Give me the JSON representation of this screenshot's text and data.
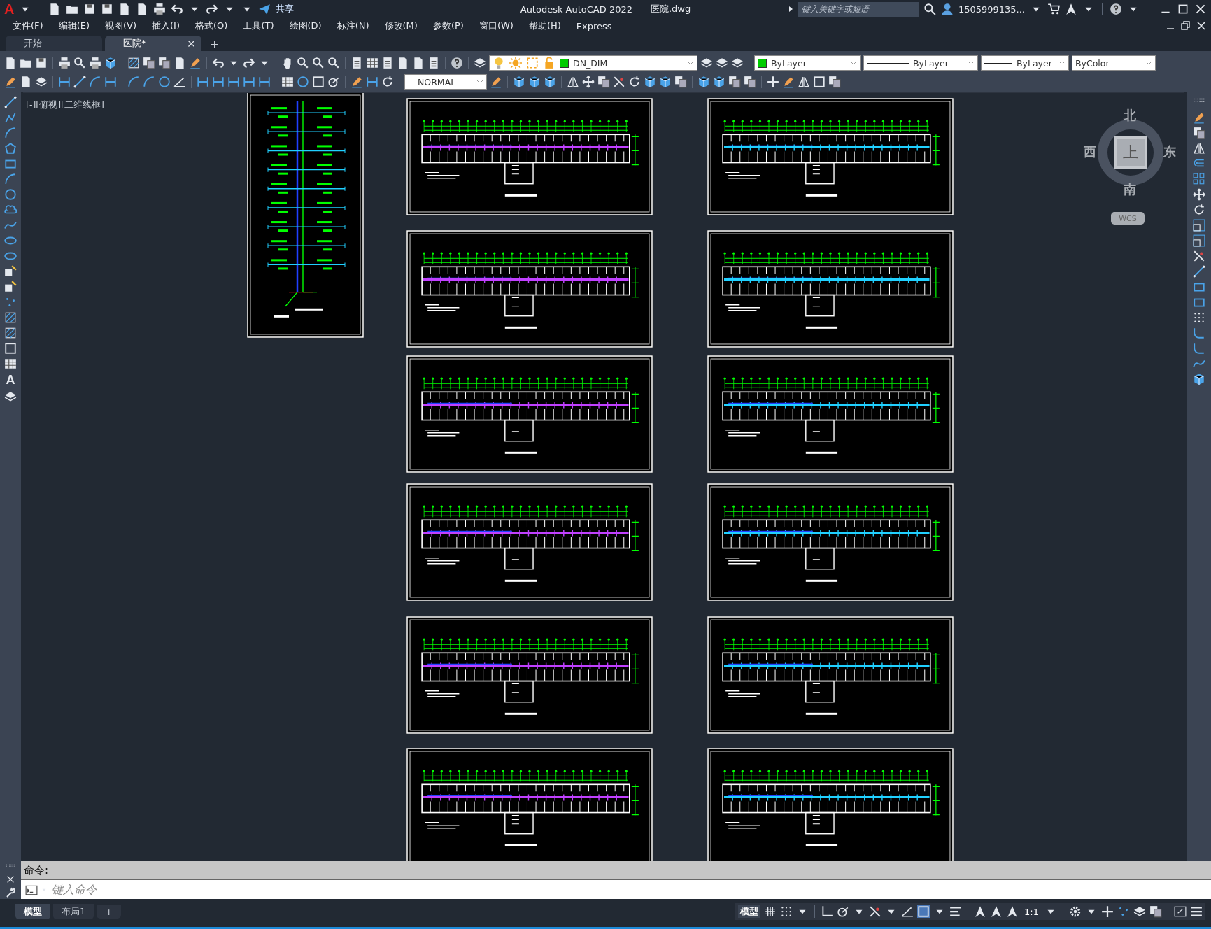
{
  "title_bar": {
    "logo": "A",
    "share": "共享",
    "app_title": "Autodesk AutoCAD 2022",
    "file_name": "医院.dwg",
    "search": {
      "placeholder": "键入关键字或短语"
    },
    "user": "1505999135..."
  },
  "menu": [
    "文件(F)",
    "编辑(E)",
    "视图(V)",
    "插入(I)",
    "格式(O)",
    "工具(T)",
    "绘图(D)",
    "标注(N)",
    "修改(M)",
    "参数(P)",
    "窗口(W)",
    "帮助(H)",
    "Express"
  ],
  "tabs": [
    {
      "label": "开始",
      "selected": false,
      "closable": false
    },
    {
      "label": "医院*",
      "selected": true,
      "closable": true
    }
  ],
  "new_tab": "+",
  "properties": {
    "layer": "DN_DIM",
    "color_setting": "ByLayer",
    "linetype": "ByLayer",
    "lineweight": "ByLayer",
    "plot_style": "ByColor",
    "dim_style": "NORMAL"
  },
  "draw_tools": {
    "text_tool": "A"
  },
  "viewport_label": "[-][俯视][二维线框]",
  "viewcube": {
    "north": "北",
    "south": "南",
    "east": "东",
    "west": "西",
    "top": "上",
    "ucs": "WCS"
  },
  "sheets": [
    {
      "kind": "riser"
    },
    {
      "kind": "plan",
      "color": "#c040ff"
    },
    {
      "kind": "plan",
      "color": "#20d0ff"
    },
    {
      "kind": "plan",
      "color": "#c040ff"
    },
    {
      "kind": "plan",
      "color": "#20d0ff"
    },
    {
      "kind": "plan",
      "color": "#c040ff"
    },
    {
      "kind": "plan",
      "color": "#20d0ff"
    },
    {
      "kind": "plan",
      "color": "#c040ff"
    },
    {
      "kind": "plan",
      "color": "#20d0ff"
    },
    {
      "kind": "plan",
      "color": "#c040ff"
    },
    {
      "kind": "plan",
      "color": "#20d0ff"
    },
    {
      "kind": "plan",
      "color": "#c040ff"
    },
    {
      "kind": "plan",
      "color": "#20d0ff"
    }
  ],
  "command": {
    "history": "命令:",
    "placeholder": "键入命令"
  },
  "layout_tabs": [
    {
      "label": "模型",
      "selected": true
    },
    {
      "label": "布局1",
      "selected": false
    }
  ],
  "new_layout": "+",
  "status_bar": {
    "space": "模型",
    "scale": "1:1"
  }
}
